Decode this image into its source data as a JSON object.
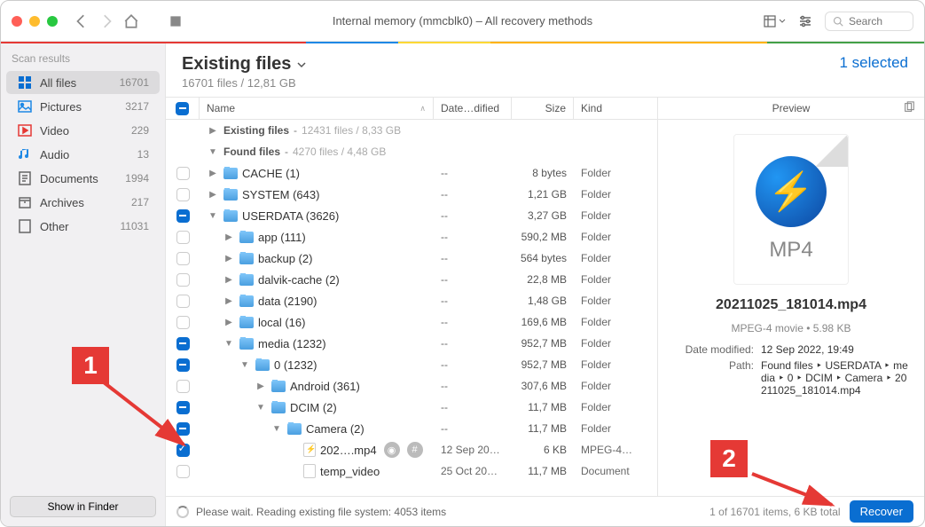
{
  "window_title": "Internal memory (mmcblk0) – All recovery methods",
  "search_placeholder": "Search",
  "sidebar_title": "Scan results",
  "sidebar": [
    {
      "icon": "grid",
      "label": "All files",
      "count": "16701",
      "color": "#0a6ed1",
      "active": true
    },
    {
      "icon": "image",
      "label": "Pictures",
      "count": "3217",
      "color": "#1e88e5"
    },
    {
      "icon": "video",
      "label": "Video",
      "count": "229",
      "color": "#e53935"
    },
    {
      "icon": "music",
      "label": "Audio",
      "count": "13",
      "color": "#1e88e5"
    },
    {
      "icon": "doc",
      "label": "Documents",
      "count": "1994",
      "color": "#666"
    },
    {
      "icon": "archive",
      "label": "Archives",
      "count": "217",
      "color": "#666"
    },
    {
      "icon": "other",
      "label": "Other",
      "count": "11031",
      "color": "#666"
    }
  ],
  "show_in_finder": "Show in Finder",
  "header_title": "Existing files",
  "header_sub": "16701 files / 12,81 GB",
  "selected_text": "1 selected",
  "columns": {
    "name": "Name",
    "date": "Date…dified",
    "size": "Size",
    "kind": "Kind"
  },
  "sections": [
    {
      "label": "Existing files",
      "meta": "12431 files / 8,33 GB",
      "expanded": false
    },
    {
      "label": "Found files",
      "meta": "4270 files / 4,48 GB",
      "expanded": true
    }
  ],
  "rows": [
    {
      "chk": "empty",
      "indent": 0,
      "disc": "▶",
      "type": "folder",
      "name": "CACHE (1)",
      "date": "--",
      "size": "8 bytes",
      "kind": "Folder"
    },
    {
      "chk": "empty",
      "indent": 0,
      "disc": "▶",
      "type": "folder",
      "name": "SYSTEM (643)",
      "date": "--",
      "size": "1,21 GB",
      "kind": "Folder"
    },
    {
      "chk": "minus",
      "indent": 0,
      "disc": "▼",
      "type": "folder",
      "name": "USERDATA (3626)",
      "date": "--",
      "size": "3,27 GB",
      "kind": "Folder"
    },
    {
      "chk": "empty",
      "indent": 1,
      "disc": "▶",
      "type": "folder",
      "name": "app (111)",
      "date": "--",
      "size": "590,2 MB",
      "kind": "Folder"
    },
    {
      "chk": "empty",
      "indent": 1,
      "disc": "▶",
      "type": "folder",
      "name": "backup (2)",
      "date": "--",
      "size": "564 bytes",
      "kind": "Folder"
    },
    {
      "chk": "empty",
      "indent": 1,
      "disc": "▶",
      "type": "folder",
      "name": "dalvik-cache (2)",
      "date": "--",
      "size": "22,8 MB",
      "kind": "Folder"
    },
    {
      "chk": "empty",
      "indent": 1,
      "disc": "▶",
      "type": "folder",
      "name": "data (2190)",
      "date": "--",
      "size": "1,48 GB",
      "kind": "Folder"
    },
    {
      "chk": "empty",
      "indent": 1,
      "disc": "▶",
      "type": "folder",
      "name": "local (16)",
      "date": "--",
      "size": "169,6 MB",
      "kind": "Folder"
    },
    {
      "chk": "minus",
      "indent": 1,
      "disc": "▼",
      "type": "folder",
      "name": "media (1232)",
      "date": "--",
      "size": "952,7 MB",
      "kind": "Folder"
    },
    {
      "chk": "minus",
      "indent": 2,
      "disc": "▼",
      "type": "folder",
      "name": "0 (1232)",
      "date": "--",
      "size": "952,7 MB",
      "kind": "Folder"
    },
    {
      "chk": "empty",
      "indent": 3,
      "disc": "▶",
      "type": "folder",
      "name": "Android (361)",
      "date": "--",
      "size": "307,6 MB",
      "kind": "Folder"
    },
    {
      "chk": "minus",
      "indent": 3,
      "disc": "▼",
      "type": "folder",
      "name": "DCIM (2)",
      "date": "--",
      "size": "11,7 MB",
      "kind": "Folder"
    },
    {
      "chk": "minus",
      "indent": 4,
      "disc": "▼",
      "type": "folder",
      "name": "Camera (2)",
      "date": "--",
      "size": "11,7 MB",
      "kind": "Folder"
    },
    {
      "chk": "checked",
      "indent": 5,
      "disc": "",
      "type": "mp4",
      "name": "202….mp4",
      "date": "12 Sep 20…",
      "size": "6 KB",
      "kind": "MPEG-4…",
      "extra": true
    },
    {
      "chk": "empty",
      "indent": 5,
      "disc": "",
      "type": "file",
      "name": "temp_video",
      "date": "25 Oct 20…",
      "size": "11,7 MB",
      "kind": "Document"
    }
  ],
  "preview": {
    "header": "Preview",
    "ext": "MP4",
    "filename": "20211025_181014.mp4",
    "meta": "MPEG-4 movie • 5.98 KB",
    "date_label": "Date modified:",
    "date_value": "12 Sep 2022, 19:49",
    "path_label": "Path:",
    "path_value": "Found files ‣ USERDATA ‣ me dia ‣ 0 ‣ DCIM ‣ Camera ‣ 20 211025_181014.mp4"
  },
  "footer": {
    "status": "Please wait. Reading existing file system: 4053 items",
    "summary": "1 of 16701 items, 6 KB total",
    "recover": "Recover"
  },
  "annotations": {
    "one": "1",
    "two": "2"
  }
}
